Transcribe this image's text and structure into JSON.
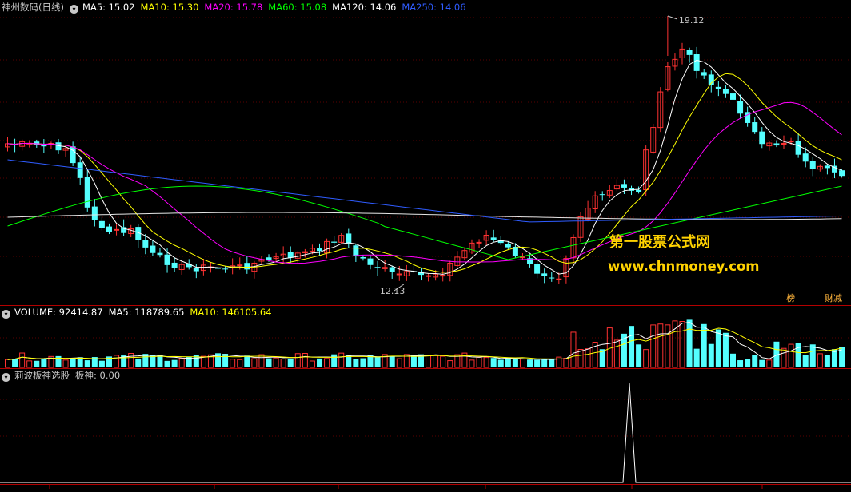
{
  "main_panel": {
    "title": "神州数码(日线)",
    "ma_items": [
      {
        "label": "MA5: 15.02",
        "color": "#ffffff"
      },
      {
        "label": "MA10: 15.30",
        "color": "#ffff00"
      },
      {
        "label": "MA20: 15.78",
        "color": "#ff00ff"
      },
      {
        "label": "MA60: 15.08",
        "color": "#00ff00"
      },
      {
        "label": "MA120: 14.06",
        "color": "#ffffff"
      },
      {
        "label": "MA250: 14.06",
        "color": "#2f5cff"
      }
    ],
    "high_label": "19.12",
    "low_label": "12.13",
    "badge_left": "榜",
    "badge_right": "财减"
  },
  "watermark": {
    "line1": "第一股票公式网",
    "line2": "www.chnmoney.com"
  },
  "volume_panel": {
    "items": [
      {
        "label": "VOLUME: 92414.87",
        "color": "#ffffff"
      },
      {
        "label": "MA5: 118789.65",
        "color": "#ffffff"
      },
      {
        "label": "MA10: 146105.64",
        "color": "#ffff00"
      }
    ]
  },
  "indicator_panel": {
    "name": "莉波板神选股",
    "value_label": "板神: 0.00"
  },
  "colors": {
    "up": "#ff3232",
    "down": "#54ffff",
    "axis": "#b40000",
    "grid": "#5a0000"
  },
  "icons": [
    "circle-toggle-icon"
  ]
}
